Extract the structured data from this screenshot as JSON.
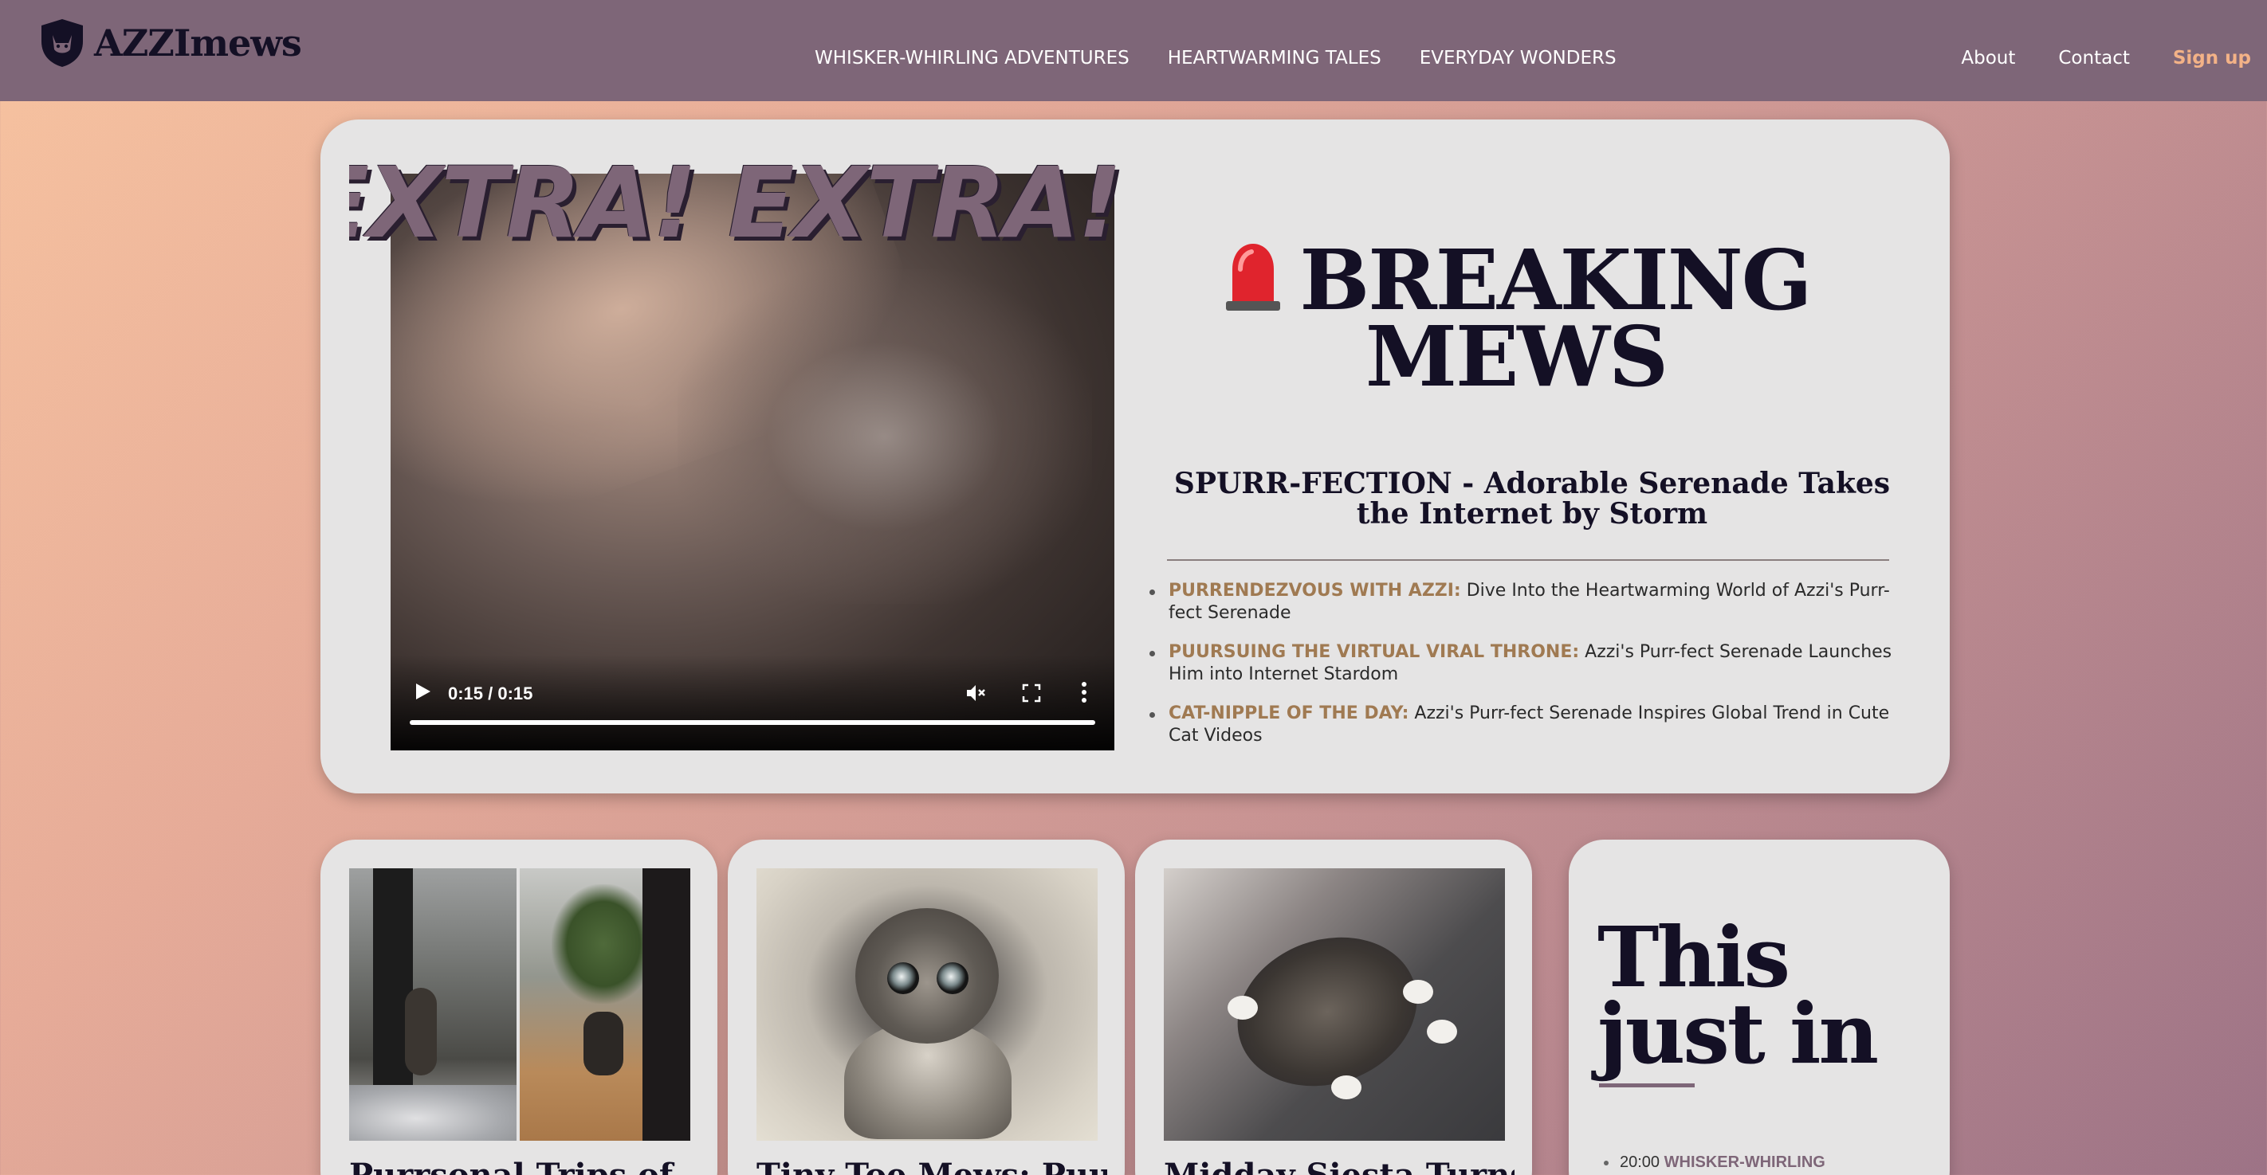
{
  "header": {
    "logo_text": "AZZImews",
    "nav": [
      {
        "label": "WHISKER-WHIRLING ADVENTURES"
      },
      {
        "label": "HEARTWARMING TALES"
      },
      {
        "label": "EVERYDAY WONDERS"
      }
    ],
    "right_nav": {
      "about": "About",
      "contact": "Contact",
      "signup": "Sign up"
    }
  },
  "hero": {
    "marquee": "EXTRA! EXTRA! EXTRA! EXTRA!",
    "video": {
      "time": "0:15 / 0:15",
      "progress": 1.0
    },
    "breaking_line1": "BREAKING",
    "breaking_line2": "MEWS",
    "headline": "SPURR-FECTION - Adorable Serenade Takes the Internet by Storm",
    "bullets": [
      {
        "tag": "PURRENDEZVOUS WITH AZZI:",
        "text": " Dive Into the Heartwarming World of Azzi's Purr-fect Serenade"
      },
      {
        "tag": "PUURSUING THE VIRTUAL VIRAL THRONE:",
        "text": " Azzi's Purr-fect Serenade Launches Him into Internet Stardom"
      },
      {
        "tag": "CAT-NIPPLE OF THE DAY:",
        "text": " Azzi's Purr-fect Serenade Inspires Global Trend in Cute Cat Videos"
      }
    ]
  },
  "cards": [
    {
      "title": "Purrsonal Trips of..."
    },
    {
      "title": "Tiny Toe Mews: Puuurrr"
    },
    {
      "title": "Midday Siesta Turns Into"
    }
  ],
  "just_in": {
    "title_line1": "This",
    "title_line2": "just in",
    "items": [
      {
        "time": "20:00",
        "tag": "WHISKER-WHIRLING"
      }
    ]
  },
  "colors": {
    "header_bg": "#7e6678",
    "accent_signup": "#f3b287",
    "bullet_tag": "#a07a52",
    "heading": "#141025",
    "card_bg": "#e5e4e4"
  }
}
